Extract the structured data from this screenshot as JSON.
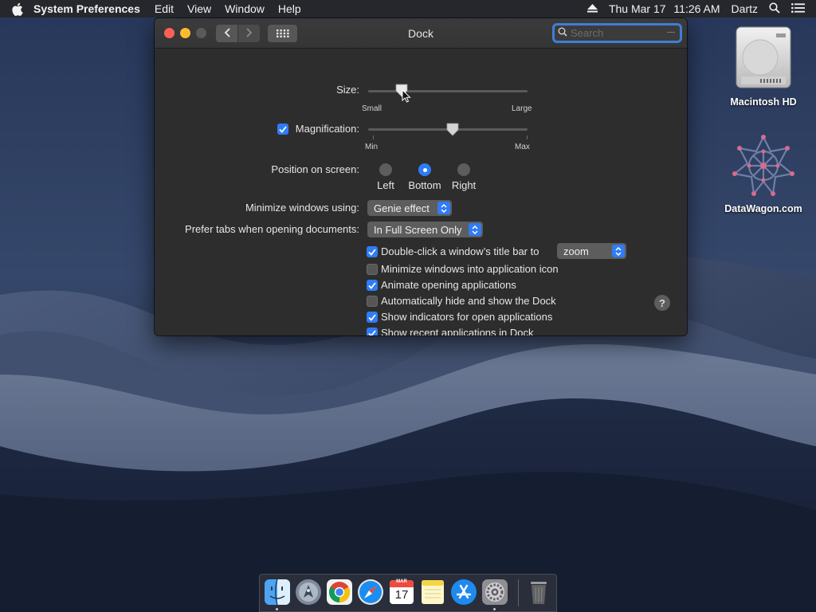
{
  "menubar": {
    "app_name": "System Preferences",
    "items": [
      "Edit",
      "View",
      "Window",
      "Help"
    ],
    "clock": {
      "day": "Thu Mar 17",
      "time": "11:26 AM"
    },
    "user": "Dartz",
    "icons": [
      "apple-icon",
      "eject-icon",
      "spotlight-icon",
      "notification-center-icon"
    ]
  },
  "desktop": {
    "icons": [
      {
        "label": "Macintosh HD",
        "icon": "hard-drive-icon"
      },
      {
        "label": "DataWagon.com",
        "icon": "datawagon-logo-icon"
      }
    ]
  },
  "window": {
    "title": "Dock",
    "search": {
      "placeholder": "Search",
      "value": ""
    },
    "size": {
      "label": "Size:",
      "min_label": "Small",
      "max_label": "Large",
      "value": 0.21
    },
    "magnification": {
      "label": "Magnification:",
      "checked": true,
      "min_label": "Min",
      "max_label": "Max",
      "value": 0.53
    },
    "position": {
      "label": "Position on screen:",
      "options": [
        "Left",
        "Bottom",
        "Right"
      ],
      "selected": "Bottom"
    },
    "minimize_using": {
      "label": "Minimize windows using:",
      "value": "Genie effect"
    },
    "prefer_tabs": {
      "label": "Prefer tabs when opening documents:",
      "value": "In Full Screen Only"
    },
    "double_click": {
      "label": "Double-click a window’s title bar to",
      "checked": true,
      "value": "zoom"
    },
    "options": [
      {
        "label": "Minimize windows into application icon",
        "checked": false
      },
      {
        "label": "Animate opening applications",
        "checked": true
      },
      {
        "label": "Automatically hide and show the Dock",
        "checked": false
      },
      {
        "label": "Show indicators for open applications",
        "checked": true
      },
      {
        "label": "Show recent applications in Dock",
        "checked": true
      }
    ],
    "help": "?"
  },
  "dock": {
    "apps": [
      {
        "name": "Finder",
        "icon": "finder-icon",
        "running": true
      },
      {
        "name": "Launchpad",
        "icon": "launchpad-icon",
        "running": false
      },
      {
        "name": "Chrome",
        "icon": "chrome-icon",
        "running": false
      },
      {
        "name": "Safari",
        "icon": "safari-icon",
        "running": false
      },
      {
        "name": "Calendar",
        "icon": "calendar-icon",
        "running": false,
        "month": "MAR",
        "day": "17"
      },
      {
        "name": "Notes",
        "icon": "notes-icon",
        "running": false
      },
      {
        "name": "App Store",
        "icon": "app-store-icon",
        "running": false
      },
      {
        "name": "System Preferences",
        "icon": "system-preferences-icon",
        "running": true
      },
      {
        "name": "Trash",
        "icon": "trash-icon",
        "running": false
      }
    ]
  },
  "colors": {
    "accent": "#2f7cf6",
    "close": "#fe5f57",
    "minimize": "#febc2e"
  }
}
